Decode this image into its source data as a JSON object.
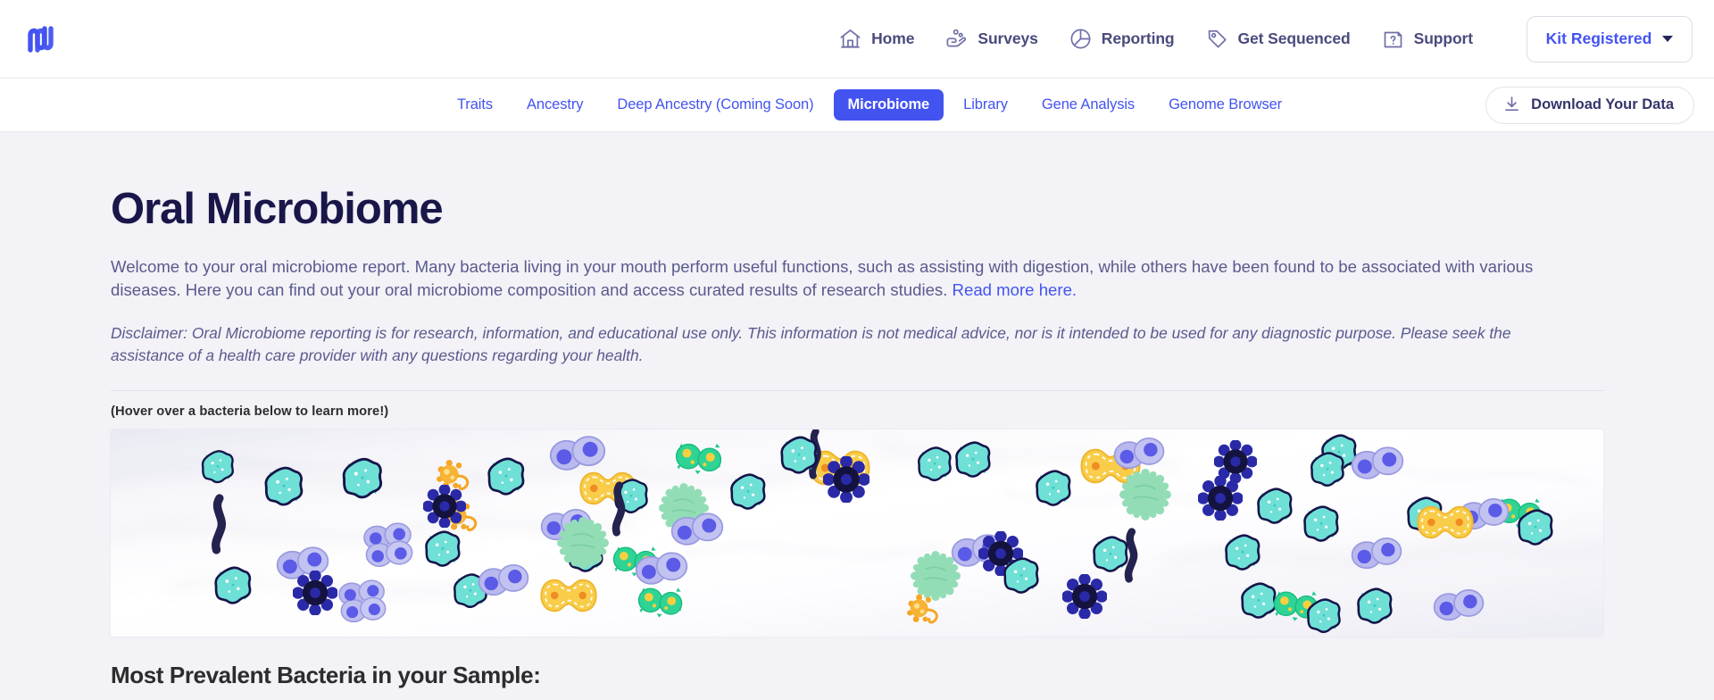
{
  "brand": {
    "logo_icon": "nebula-wave-logo"
  },
  "topnav": {
    "items": [
      {
        "label": "Home",
        "icon": "home-icon"
      },
      {
        "label": "Surveys",
        "icon": "survey-hand-icon"
      },
      {
        "label": "Reporting",
        "icon": "pie-chart-icon"
      },
      {
        "label": "Get Sequenced",
        "icon": "tag-icon"
      },
      {
        "label": "Support",
        "icon": "help-document-icon"
      }
    ],
    "kit_button": {
      "label": "Kit Registered",
      "icon": "chevron-down-icon"
    }
  },
  "subnav": {
    "tabs": [
      {
        "label": "Traits",
        "active": false
      },
      {
        "label": "Ancestry",
        "active": false
      },
      {
        "label": "Deep Ancestry (Coming Soon)",
        "active": false
      },
      {
        "label": "Microbiome",
        "active": true
      },
      {
        "label": "Library",
        "active": false
      },
      {
        "label": "Gene Analysis",
        "active": false
      },
      {
        "label": "Genome Browser",
        "active": false
      }
    ],
    "download_button": {
      "label": "Download Your Data",
      "icon": "download-icon"
    }
  },
  "page": {
    "title": "Oral Microbiome",
    "intro_text": "Welcome to your oral microbiome report. Many bacteria living in your mouth perform useful functions, such as assisting with digestion, while others have been found to be associated with various diseases. Here you can find out your oral microbiome composition and access curated results of research studies. ",
    "intro_link": "Read more here.",
    "disclaimer": "Disclaimer: Oral Microbiome reporting is for research, information, and educational use only. This information is not medical advice, nor is it intended to be used for any diagnostic purpose. Please seek the assistance of a health care provider with any questions regarding your health.",
    "hover_hint": "(Hover over a bacteria below to learn more!)",
    "section_title": "Most Prevalent Bacteria in your Sample:"
  },
  "colors": {
    "accent_blue": "#4353f0",
    "heading_navy": "#191749",
    "body_text": "#5a5a8e",
    "page_bg": "#f2f2f7",
    "bacteria_teal": "#6ddcd0",
    "bacteria_periwinkle": "#6b6be8",
    "bacteria_yellow": "#f9c942",
    "bacteria_green": "#2fcf8f",
    "bacteria_mint": "#8fdcb4",
    "bacteria_darknavy": "#15144a",
    "bacteria_orange": "#f5a623"
  }
}
